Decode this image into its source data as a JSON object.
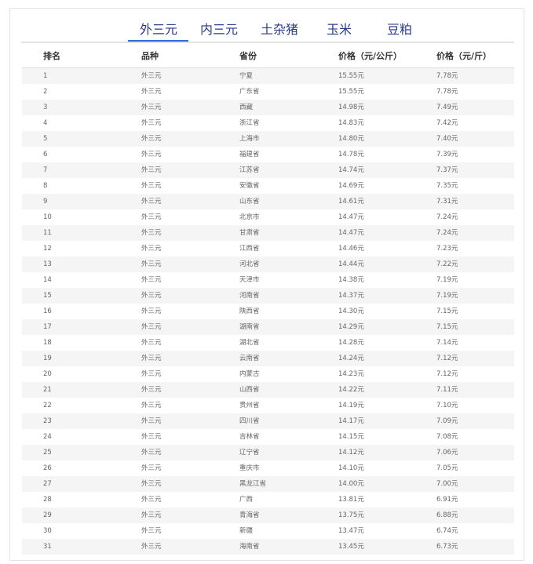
{
  "tabs": [
    "外三元",
    "内三元",
    "土杂猪",
    "玉米",
    "豆粕"
  ],
  "active_tab": 0,
  "table": {
    "headers": [
      "排名",
      "品种",
      "省份",
      "价格（元/公斤）",
      "价格（元/斤）"
    ],
    "rows": [
      [
        "1",
        "外三元",
        "宁夏",
        "15.55元",
        "7.78元"
      ],
      [
        "2",
        "外三元",
        "广东省",
        "15.55元",
        "7.78元"
      ],
      [
        "3",
        "外三元",
        "西藏",
        "14.98元",
        "7.49元"
      ],
      [
        "4",
        "外三元",
        "浙江省",
        "14.83元",
        "7.42元"
      ],
      [
        "5",
        "外三元",
        "上海市",
        "14.80元",
        "7.40元"
      ],
      [
        "6",
        "外三元",
        "福建省",
        "14.78元",
        "7.39元"
      ],
      [
        "7",
        "外三元",
        "江苏省",
        "14.74元",
        "7.37元"
      ],
      [
        "8",
        "外三元",
        "安徽省",
        "14.69元",
        "7.35元"
      ],
      [
        "9",
        "外三元",
        "山东省",
        "14.61元",
        "7.31元"
      ],
      [
        "10",
        "外三元",
        "北京市",
        "14.47元",
        "7.24元"
      ],
      [
        "11",
        "外三元",
        "甘肃省",
        "14.47元",
        "7.24元"
      ],
      [
        "12",
        "外三元",
        "江西省",
        "14.46元",
        "7.23元"
      ],
      [
        "13",
        "外三元",
        "河北省",
        "14.44元",
        "7.22元"
      ],
      [
        "14",
        "外三元",
        "天津市",
        "14.38元",
        "7.19元"
      ],
      [
        "15",
        "外三元",
        "河南省",
        "14.37元",
        "7.19元"
      ],
      [
        "16",
        "外三元",
        "陕西省",
        "14.30元",
        "7.15元"
      ],
      [
        "17",
        "外三元",
        "湖南省",
        "14.29元",
        "7.15元"
      ],
      [
        "18",
        "外三元",
        "湖北省",
        "14.28元",
        "7.14元"
      ],
      [
        "19",
        "外三元",
        "云南省",
        "14.24元",
        "7.12元"
      ],
      [
        "20",
        "外三元",
        "内蒙古",
        "14.23元",
        "7.12元"
      ],
      [
        "21",
        "外三元",
        "山西省",
        "14.22元",
        "7.11元"
      ],
      [
        "22",
        "外三元",
        "贵州省",
        "14.19元",
        "7.10元"
      ],
      [
        "23",
        "外三元",
        "四川省",
        "14.17元",
        "7.09元"
      ],
      [
        "24",
        "外三元",
        "吉林省",
        "14.15元",
        "7.08元"
      ],
      [
        "25",
        "外三元",
        "辽宁省",
        "14.12元",
        "7.06元"
      ],
      [
        "26",
        "外三元",
        "重庆市",
        "14.10元",
        "7.05元"
      ],
      [
        "27",
        "外三元",
        "黑龙江省",
        "14.00元",
        "7.00元"
      ],
      [
        "28",
        "外三元",
        "广西",
        "13.81元",
        "6.91元"
      ],
      [
        "29",
        "外三元",
        "青海省",
        "13.75元",
        "6.88元"
      ],
      [
        "30",
        "外三元",
        "新疆",
        "13.47元",
        "6.74元"
      ],
      [
        "31",
        "外三元",
        "海南省",
        "13.45元",
        "6.73元"
      ]
    ]
  }
}
